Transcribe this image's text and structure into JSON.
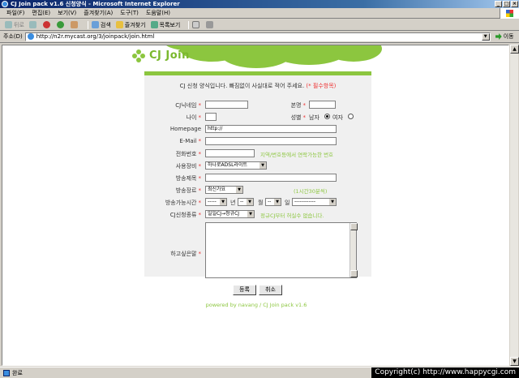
{
  "window": {
    "title": "CJ Join pack v1.6 신청양식 - Microsoft Internet Explorer",
    "minimize": "_",
    "maximize": "□",
    "close": "×"
  },
  "menu": [
    "파일(F)",
    "편집(E)",
    "보기(V)",
    "즐겨찾기(A)",
    "도구(T)",
    "도움말(H)"
  ],
  "toolbar": {
    "back": "뒤로",
    "forward": "",
    "stop": "",
    "refresh": "",
    "home": "",
    "search": "검색",
    "favorites": "즐겨찾기",
    "history": "목록보기"
  },
  "address": {
    "label": "주소(D)",
    "url": "http://n2r.mycast.org/3/joinpack/join.html",
    "go": "이동"
  },
  "logo": "CJ Join",
  "form": {
    "intro": "CJ 신청 양식입니다. 빠짐없이 사실대로 적어 주세요.",
    "intro_req": "(* 필수항목)",
    "labels": {
      "nickname": "CJ닉네임",
      "real_name": "본명",
      "age": "나이",
      "gender": "성별",
      "male": "남자",
      "female": "여자",
      "homepage": "Homepage",
      "email": "E-Mail",
      "phone": "전화번호",
      "equipment": "사용장비",
      "broadcast_title": "방송제목",
      "broadcast_genre": "방송장르",
      "broadcast_time": "방송가능시간",
      "year": "년",
      "month": "월",
      "day": "일",
      "cj_type": "CJ신청종류",
      "message": "하고싶은말"
    },
    "values": {
      "homepage": "http://",
      "equipment": "하나로ADSL라이트",
      "genre": "최신가요",
      "year": "-----",
      "month": "--",
      "day": "--",
      "day_after": "------------",
      "cj_type": "일일CJ→정규CJ"
    },
    "hints": {
      "phone": "지역/번호등에서 연락가능한 번호",
      "genre": "(1시간30분씩)",
      "cj_type": "정규CJ부터 허실수 없습니다."
    },
    "req": "*"
  },
  "buttons": {
    "submit": "등록",
    "cancel": "취소"
  },
  "footer": "powered by navang / CJ Join pack v1.6",
  "status": {
    "text": "완료",
    "copyright": "Copyright(c) http://www.happycgi.com"
  }
}
